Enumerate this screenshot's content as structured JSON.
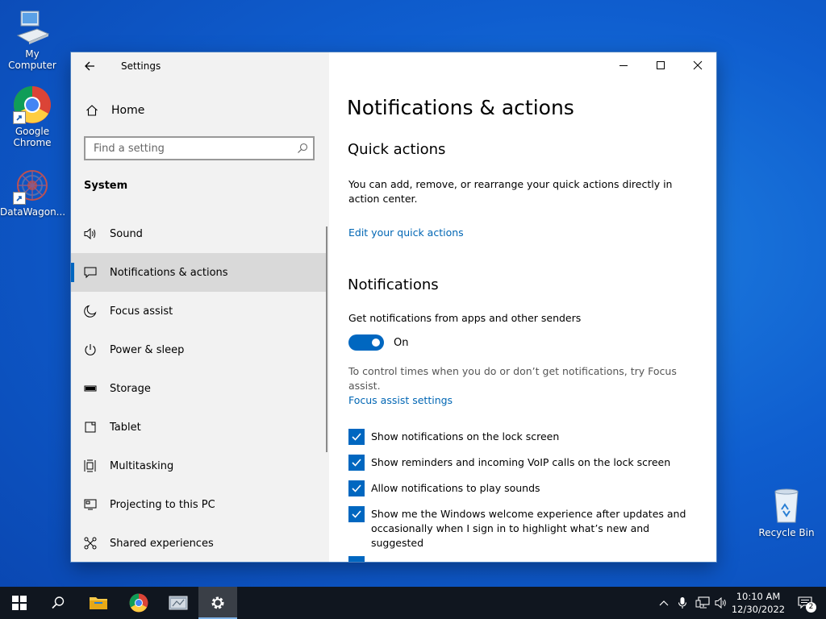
{
  "desktop": {
    "icons": [
      {
        "label": "My Computer"
      },
      {
        "label": "Google Chrome"
      },
      {
        "label": "DataWagon..."
      },
      {
        "label": "Recycle Bin"
      }
    ]
  },
  "window": {
    "app_title": "Settings",
    "home_label": "Home",
    "search_placeholder": "Find a setting",
    "section_title": "System",
    "nav": [
      {
        "label": "Sound",
        "icon": "speaker-icon"
      },
      {
        "label": "Notifications & actions",
        "icon": "message-icon",
        "active": true
      },
      {
        "label": "Focus assist",
        "icon": "moon-icon"
      },
      {
        "label": "Power & sleep",
        "icon": "power-icon"
      },
      {
        "label": "Storage",
        "icon": "storage-icon"
      },
      {
        "label": "Tablet",
        "icon": "tablet-icon"
      },
      {
        "label": "Multitasking",
        "icon": "multitasking-icon"
      },
      {
        "label": "Projecting to this PC",
        "icon": "projector-icon"
      },
      {
        "label": "Shared experiences",
        "icon": "shared-icon"
      }
    ]
  },
  "content": {
    "page_title": "Notifications & actions",
    "quick_actions": {
      "heading": "Quick actions",
      "description": "You can add, remove, or rearrange your quick actions directly in action center.",
      "link": "Edit your quick actions"
    },
    "notifications": {
      "heading": "Notifications",
      "toggle_label": "Get notifications from apps and other senders",
      "toggle_state": "On",
      "focus_hint": "To control times when you do or don’t get notifications, try Focus assist.",
      "focus_link": "Focus assist settings",
      "checkboxes": [
        {
          "label": "Show notifications on the lock screen",
          "checked": true
        },
        {
          "label": "Show reminders and incoming VoIP calls on the lock screen",
          "checked": true
        },
        {
          "label": "Allow notifications to play sounds",
          "checked": true
        },
        {
          "label": "Show me the Windows welcome experience after updates and occasionally when I sign in to highlight what’s new and suggested",
          "checked": true
        }
      ]
    }
  },
  "taskbar": {
    "time": "10:10 AM",
    "date": "12/30/2022",
    "notification_count": "2"
  },
  "colors": {
    "accent": "#0067c0",
    "link": "#0066b4"
  }
}
